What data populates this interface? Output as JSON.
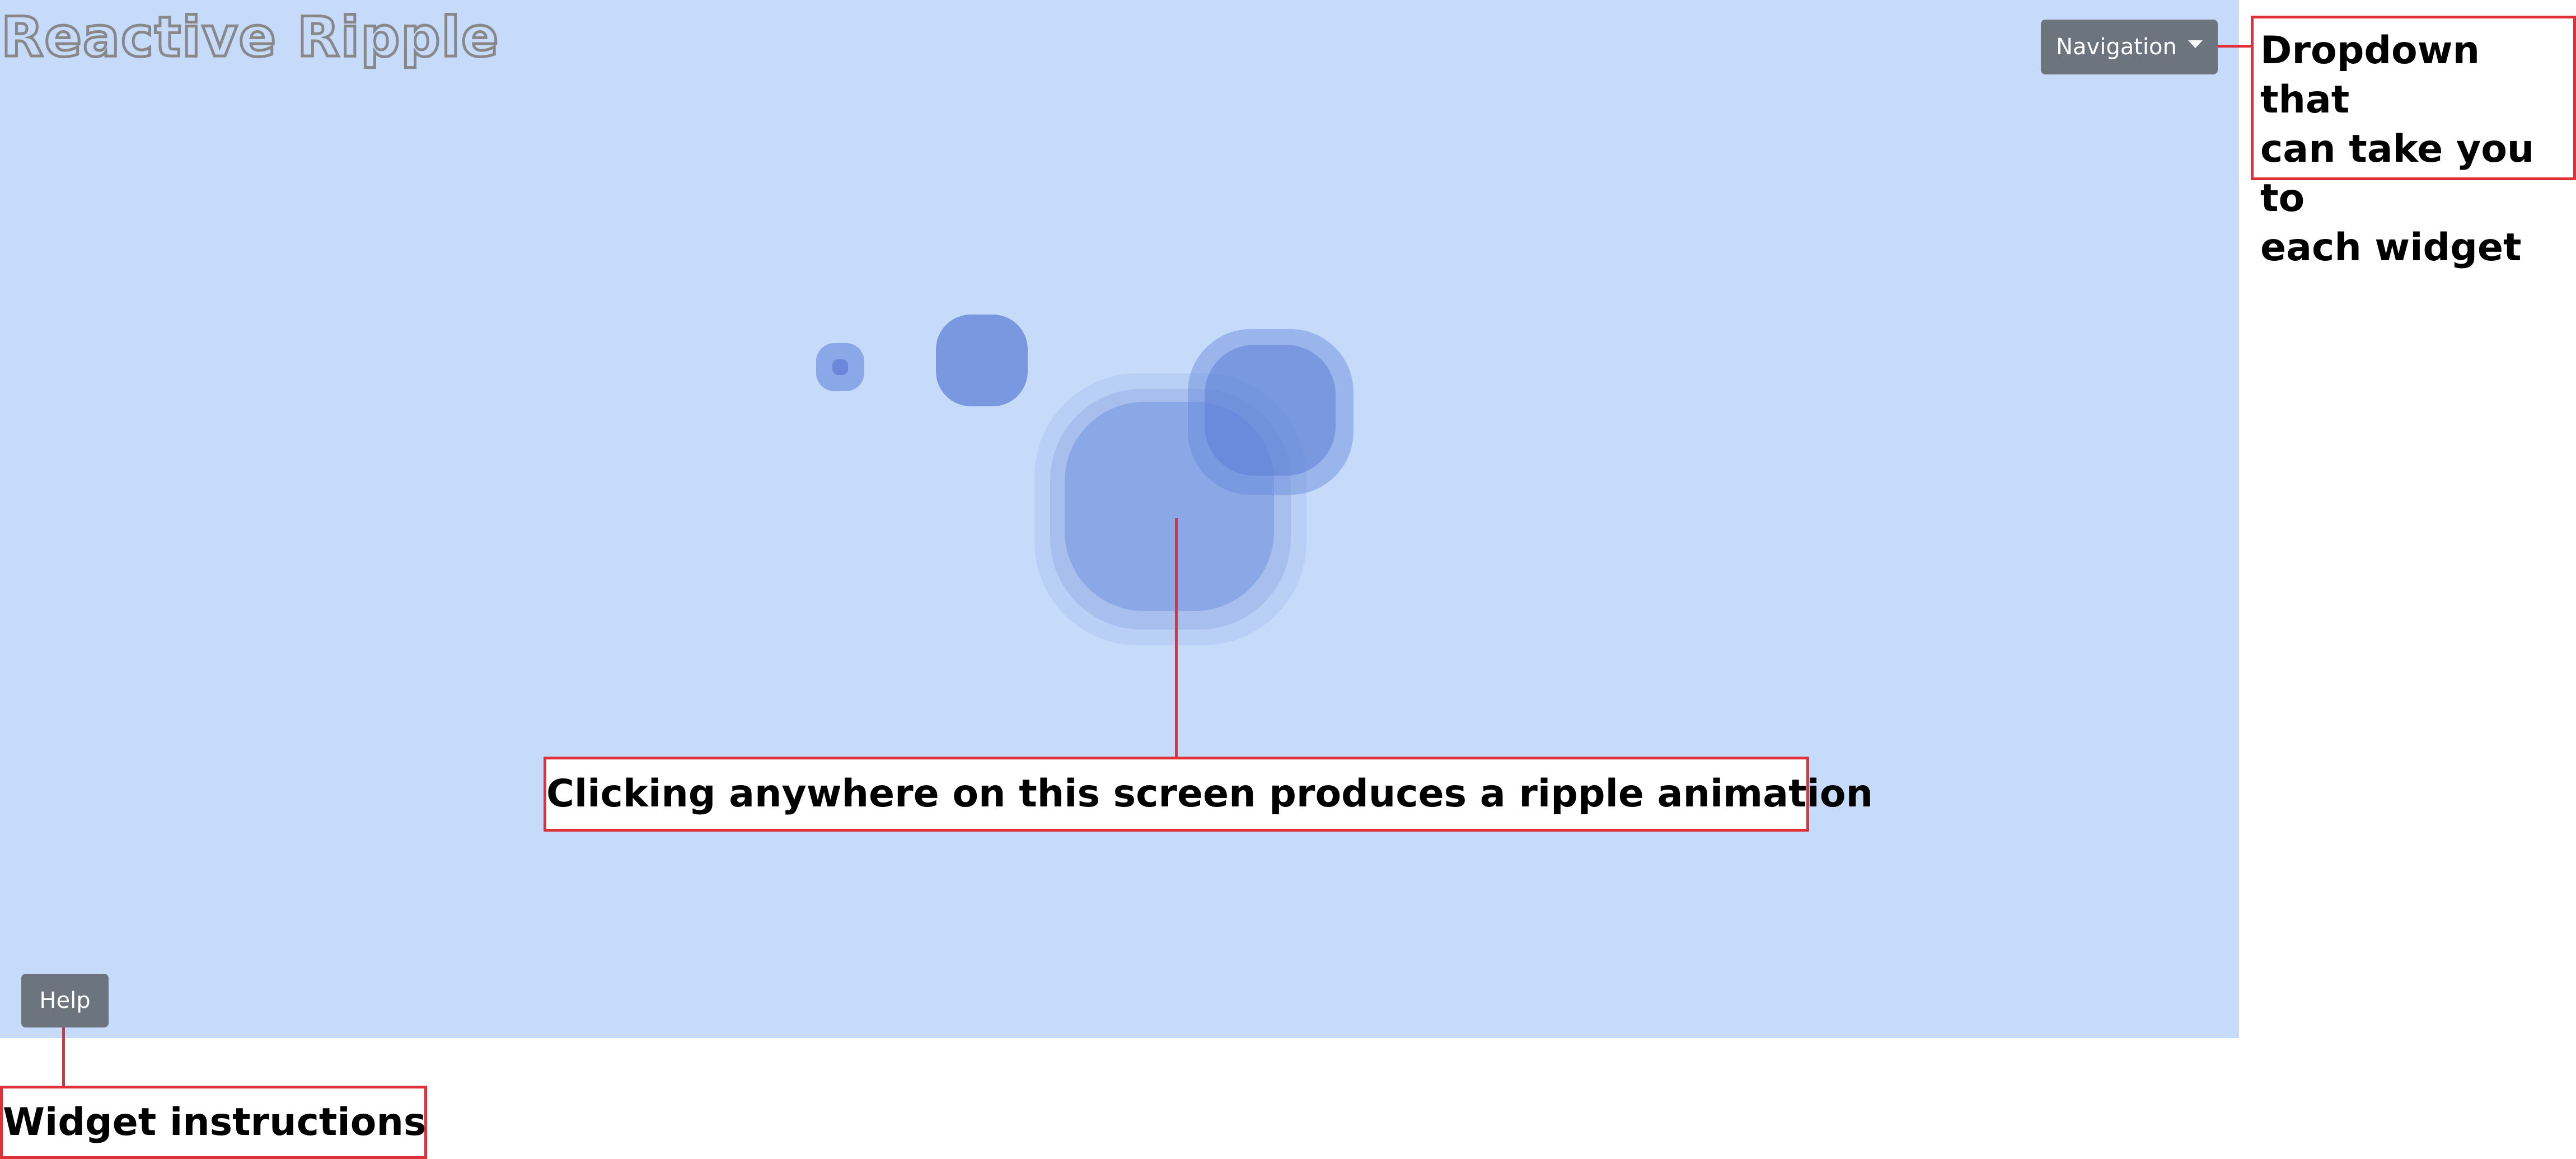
{
  "app": {
    "title": "Reactive Ripple"
  },
  "navigation": {
    "label": "Navigation",
    "caret_icon": "caret-down-icon"
  },
  "help": {
    "label": "Help"
  },
  "annotations": {
    "navigation_note": "Dropdown that\ncan take you to\neach widget",
    "canvas_note": "Clicking anywhere on this screen produces a ripple animation",
    "help_note": "Widget instructions"
  },
  "colors": {
    "canvas_background": "#c6dafa",
    "ripple": "#6f8fdb",
    "button": "#6c757d",
    "annotation_border": "#e0303a"
  }
}
